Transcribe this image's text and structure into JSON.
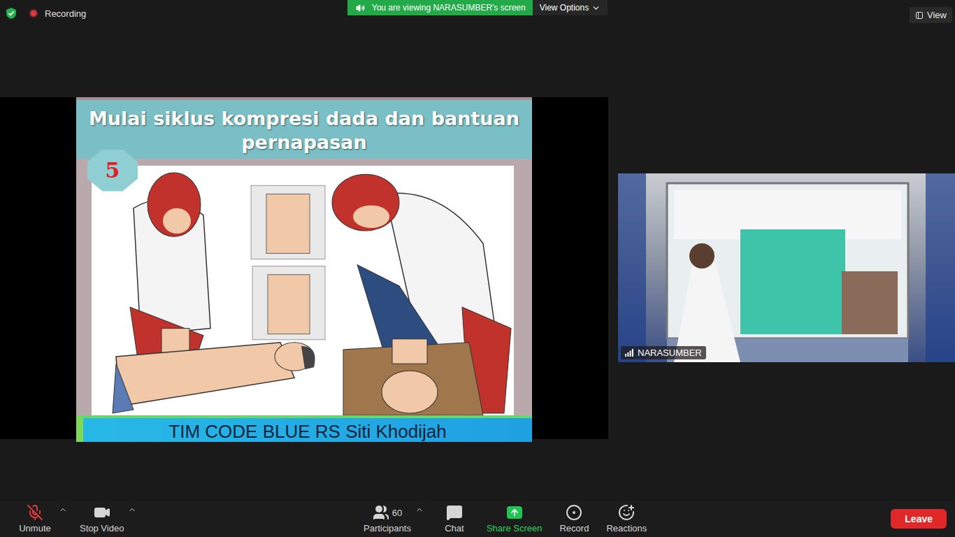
{
  "status": {
    "recording": "Recording"
  },
  "banner": {
    "text": "You are viewing NARASUMBER's screen",
    "options": "View Options"
  },
  "view_button": {
    "label": "View"
  },
  "slide": {
    "title": "Mulai siklus kompresi dada dan bantuan pernapasan",
    "step": "5",
    "footer": "TIM CODE BLUE RS Siti Khodijah"
  },
  "video": {
    "name": "NARASUMBER"
  },
  "toolbar": {
    "left": [
      {
        "label": "Unmute",
        "kind": "mic",
        "has_menu": true,
        "muted": true,
        "color": "#d5d5d5"
      },
      {
        "label": "Stop Video",
        "kind": "video",
        "has_menu": true,
        "color": "#d5d5d5"
      }
    ],
    "center": [
      {
        "label": "Participants",
        "kind": "participants",
        "count": "60",
        "has_menu": true,
        "color": "#d5d5d5"
      },
      {
        "label": "Chat",
        "kind": "chat",
        "has_menu": false,
        "color": "#d5d5d5"
      },
      {
        "label": "Share Screen",
        "kind": "share",
        "has_menu": false,
        "color": "#2fd159"
      },
      {
        "label": "Record",
        "kind": "record",
        "has_menu": false,
        "color": "#d5d5d5"
      },
      {
        "label": "Reactions",
        "kind": "reactions",
        "has_menu": false,
        "color": "#d5d5d5"
      }
    ],
    "leave": "Leave"
  }
}
